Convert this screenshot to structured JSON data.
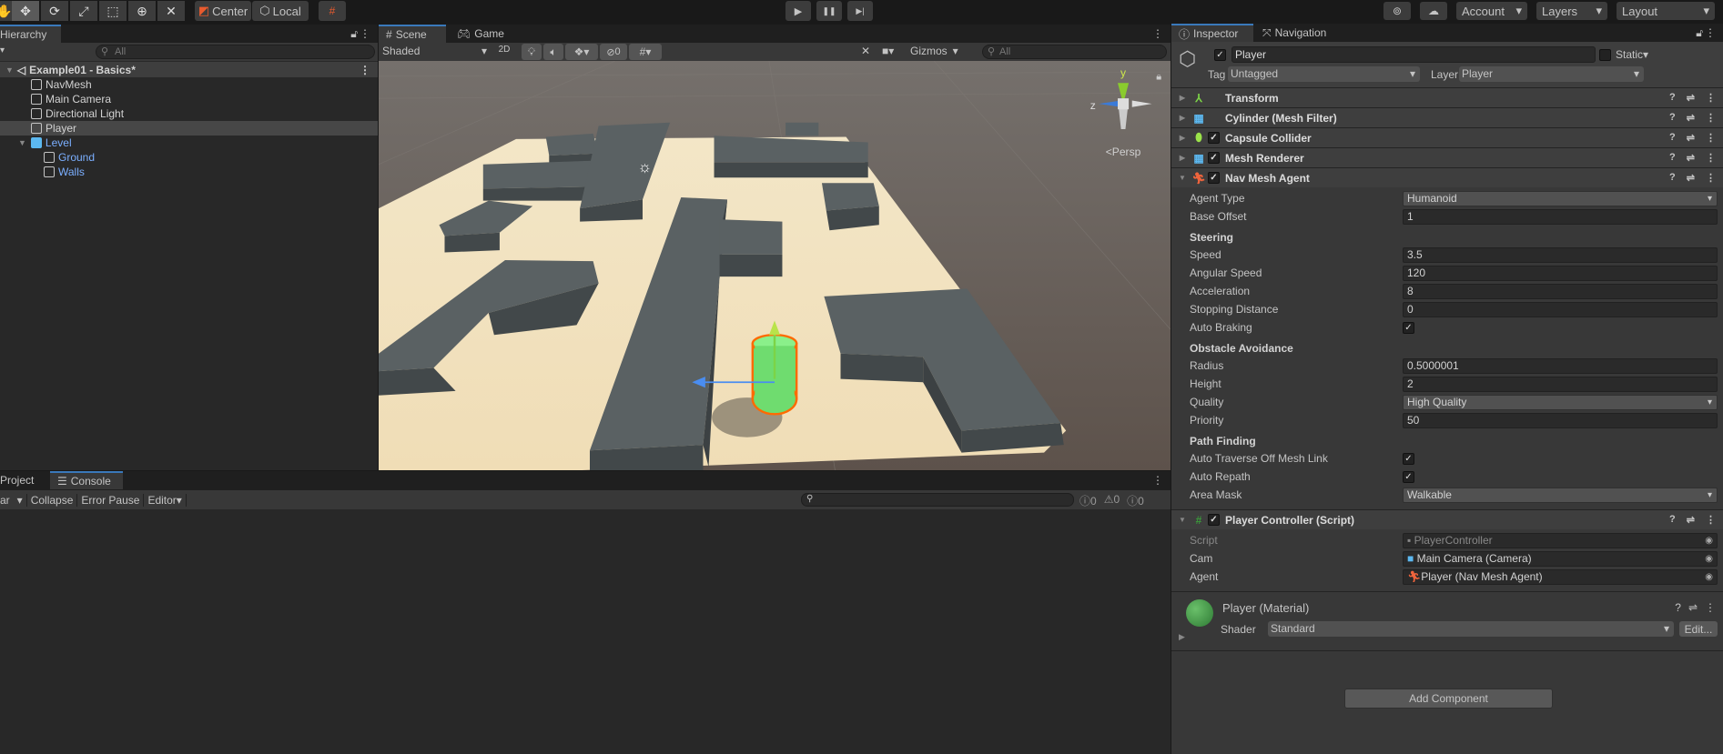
{
  "toolbar": {
    "tools": [
      "view-tool",
      "move-tool",
      "rotate-tool",
      "scale-tool",
      "rect-tool",
      "transform-tool",
      "custom-tool"
    ],
    "pivot": "Center",
    "space": "Local",
    "play": "▶",
    "pause": "❚❚",
    "step": "▶|",
    "account": "Account",
    "layers": "Layers",
    "layout": "Layout"
  },
  "hierarchy": {
    "tab": "Hierarchy",
    "search_placeholder": "All",
    "scene": "Example01 - Basics*",
    "items": [
      {
        "label": "NavMesh",
        "depth": 1
      },
      {
        "label": "Main Camera",
        "depth": 1
      },
      {
        "label": "Directional Light",
        "depth": 1
      },
      {
        "label": "Player",
        "depth": 1,
        "selected": true
      },
      {
        "label": "Level",
        "depth": 1,
        "prefab": true,
        "expanded": true
      },
      {
        "label": "Ground",
        "depth": 2,
        "prefab": true
      },
      {
        "label": "Walls",
        "depth": 2,
        "prefab": true
      }
    ]
  },
  "scene": {
    "tabs": [
      "Scene",
      "Game"
    ],
    "shading": "Shaded",
    "mode_2d": "2D",
    "hidden_count": "0",
    "gizmos": "Gizmos",
    "search_placeholder": "All",
    "projection": "<Persp",
    "axis": {
      "y": "y",
      "z": "z"
    }
  },
  "bottom": {
    "tabs": [
      "Project",
      "Console"
    ],
    "clear": "ar",
    "collapse": "Collapse",
    "error_pause": "Error Pause",
    "editor": "Editor",
    "counts": {
      "log": "0",
      "warn": "0",
      "error": "0"
    }
  },
  "inspector": {
    "tabs": [
      "Inspector",
      "Navigation"
    ],
    "name": "Player",
    "static": "Static",
    "tag_label": "Tag",
    "tag": "Untagged",
    "layer_label": "Layer",
    "layer": "Player",
    "components": [
      {
        "name": "Transform",
        "check": false
      },
      {
        "name": "Cylinder (Mesh Filter)",
        "check": false
      },
      {
        "name": "Capsule Collider",
        "check": true
      },
      {
        "name": "Mesh Renderer",
        "check": true
      },
      {
        "name": "Nav Mesh Agent",
        "check": true,
        "expanded": true
      }
    ],
    "agent": {
      "agent_type": [
        "Agent Type",
        "Humanoid"
      ],
      "base_offset": [
        "Base Offset",
        "1"
      ],
      "steering": "Steering",
      "speed": [
        "Speed",
        "3.5"
      ],
      "angular": [
        "Angular Speed",
        "120"
      ],
      "accel": [
        "Acceleration",
        "8"
      ],
      "stopping": [
        "Stopping Distance",
        "0"
      ],
      "braking": [
        "Auto Braking",
        true
      ],
      "obstacle": "Obstacle Avoidance",
      "radius": [
        "Radius",
        "0.5000001"
      ],
      "height": [
        "Height",
        "2"
      ],
      "quality": [
        "Quality",
        "High Quality"
      ],
      "priority": [
        "Priority",
        "50"
      ],
      "path": "Path Finding",
      "traverse": [
        "Auto Traverse Off Mesh Link",
        true
      ],
      "repath": [
        "Auto Repath",
        true
      ],
      "area": [
        "Area Mask",
        "Walkable"
      ]
    },
    "script_comp": {
      "name": "Player Controller (Script)",
      "script": [
        "Script",
        "PlayerController"
      ],
      "cam": [
        "Cam",
        "Main Camera (Camera)"
      ],
      "agent": [
        "Agent",
        "Player (Nav Mesh Agent)"
      ]
    },
    "material": {
      "name": "Player (Material)",
      "shader_label": "Shader",
      "shader": "Standard",
      "edit": "Edit..."
    },
    "add_component": "Add Component"
  },
  "colors": {
    "accent": "#3a79bb",
    "prefab": "#7bafff",
    "ground": "#f2e4c4",
    "wall": "#555c5e",
    "player": "#6fdc6f",
    "selection": "#ff6a00"
  }
}
